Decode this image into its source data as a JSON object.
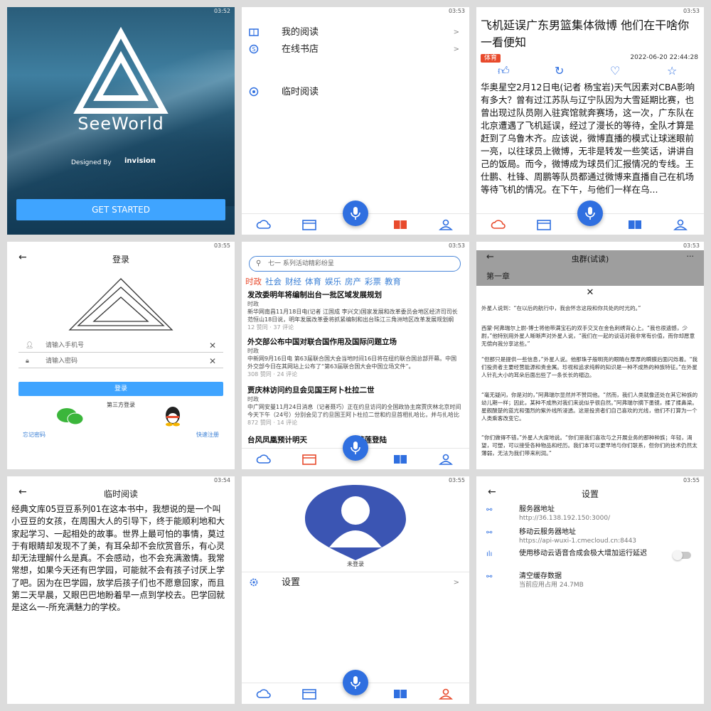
{
  "p1": {
    "time": "03:52",
    "app_name": "SeeWorld",
    "designed_by": "Designed By",
    "invision": "invision",
    "cta": "GET STARTED"
  },
  "p2": {
    "time": "03:53",
    "items": [
      {
        "label": "我的阅读",
        "chev": ">"
      },
      {
        "label": "在线书店",
        "chev": ">"
      },
      {
        "label": "临时阅读"
      }
    ]
  },
  "p3": {
    "time": "03:53",
    "headline": "飞机延误广东男篮集体微博 他们在干啥你一看便知",
    "tag": "体育",
    "date": "2022-06-20 22:44:28",
    "body": "华奥星空2月12日电(记者 杨宝岩)天气因素对CBA影响有多大？曾有过江苏队与辽宁队因为大雪延期比赛，也曾出现过队员刚入驻宾馆就奔赛场，这一次，广东队在北京遭遇了飞机延误，经过了漫长的等待，全队才算是赶到了乌鲁木齐。应该说，微博直播的模式让球迷眼前一亮，以往球员上微博，无非是转发一些笑话，讲讲自己的饭局。而今，微博成为球员们汇报情况的专线。王仕鹏、杜锋、周鹏等队员都通过微博来直播自己在机场等待飞机的情况。在下午，与他们一样在乌..."
  },
  "p4": {
    "time": "03:55",
    "title": "登录",
    "phone_placeholder": "请输入手机号",
    "pwd_placeholder": "请输入密码",
    "login": "登录",
    "third": "第三方登录",
    "forgot": "忘记密码",
    "register": "快速注册"
  },
  "p5": {
    "time": "03:53",
    "search": "七一 系列活动精彩纷呈",
    "cats": [
      "时政",
      "社会",
      "财经",
      "体育",
      "娱乐",
      "房产",
      "彩票",
      "教育"
    ],
    "news": [
      {
        "title": "发改委明年将编制出台一批区域发展规划",
        "cat": "时政",
        "body": "新华网南昌11月18日电(记者 江国成 李兴文)国家发展和改革委员会地区经济司司长范恒山18日说，明年发展改革委将抓紧编制和出台珠江三角洲地区改革发展规划纲要，成渝...",
        "stats": "12 赞同 · 37 评论"
      },
      {
        "title": "外交部公布中国对联合国作用及国际问题立场",
        "cat": "时政",
        "body": "中新网9月16日电 第63届联合国大会当地时间16日将在纽约联合国总部开幕。中国外交部今日在其网站上公布了“第63届联合国大会中国立场文件”。",
        "stats": "308 赞同 · 24 评论"
      },
      {
        "title": "贾庆林访问约旦会见国王阿卜杜拉二世",
        "cat": "时政",
        "body": "中广网安曼11月24日消息（记者聂巧）正在约旦访问的全国政协主席贾庆林北京时间今天下午（24号）分别会见了约旦国王阿卜杜拉二世和约旦首相扎哈比，并与扎哈比共同出...",
        "stats": "872 赞同 · 14 评论"
      },
      {
        "title": "台风凤凰预计明天",
        "title_tail": "花莲登陆"
      }
    ]
  },
  "p6": {
    "time": "03:53",
    "title": "虫群(试读)",
    "more": "···",
    "chapter": "第一章",
    "paras": [
      "外星人说到：“在以后的航行中，我会怀念这段和你共处的时光的。”",
      "西蒙·阿弗瑞尔上尉-博士将他带满宝石的双手交叉在金色刺绣背心上。“我也很遗憾，少尉，”他特别用外星人晰晰声对外星人说，“我们在一起的谈话对我非常有价值，而你却愿意无偿向我分享这些。”",
      "“但那只是提供一些信息，”外星人说。他那珠子般明亮的眼睛在厚厚的瞬膜后面闪烁着。“我们投资者主要经营能源和贵金属。珍视和追求纯粹的知识是一种不成熟的种族特征。”在外星人针孔大小的耳朵后面出些了一条长长的褶边。",
      "“毫无疑问，你是对的，”阿弗瑞尔显然并不赞同他。“然而，我们人类就像还处在其它种族的幼儿期一样；因此，某种不成熟对我们来说似乎很自然。”阿弗瑞尔摘下墨镜，揉了揉鼻梁。星舰酸楚的蓝光和强烈的紫外线所浸透。这是投资者们自己喜欢的光线，他们不打算为一个人类乘客改变它。",
      "“你们做得不错，”外星人大度地说。“你们是我们喜欢与之开展业务的那种种族；年轻，渴望，可塑，可以接受各种物品和经历。我们本可以更早地与你们联系，但你们的技术仍然太薄弱，无法为我们带来利润。”"
    ]
  },
  "p7": {
    "time": "03:54",
    "title": "临时阅读",
    "text": "经典文库05豆豆系列01在这本书中，我想说的是一个叫小豆豆的女孩，在周围大人的引导下，终于能顺利地和大家起学习、一起相处的故事。世界上最可怕的事情，莫过于有眼睛却发现不了美，有耳朵却不会欣赏音乐，有心灵却无法理解什么是真。不会感动，也不会充满激情。我常常想，如果今天还有巴学园，可能就不会有孩子讨厌上学了吧。因为在巴学园，放学后孩子们也不愿意回家，而且第二天早晨，又眼巴巴地盼着早一点到学校去。巴学回就是这么一-所充满魅力的学校。"
  },
  "p8": {
    "time": "03:55",
    "user": "未登录",
    "settings": "设置",
    "chev": ">"
  },
  "p9": {
    "time": "03:55",
    "title": "设置",
    "rows": [
      {
        "label": "服务器地址",
        "value": "http://36.138.192.150:3000/"
      },
      {
        "label": "移动云服务器地址",
        "value": "https://api-wuxi-1.cmecloud.cn:8443"
      },
      {
        "label": "使用移动云语音合成会极大增加运行延迟",
        "value": ""
      },
      {
        "label": "清空缓存数据",
        "value": "当前应用占用 24.7MB"
      }
    ]
  },
  "colors": {
    "accent": "#2f6fe0",
    "red": "#e84a2c",
    "button": "#3fa4ff"
  }
}
